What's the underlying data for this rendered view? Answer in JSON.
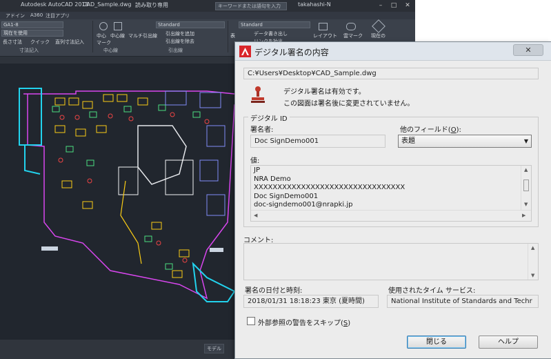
{
  "acad": {
    "title_app": "Autodesk AutoCAD 2018",
    "title_file": "CAD_Sample.dwg",
    "title_mode": "読み取り専用",
    "search_placeholder": "キーワードまたは語句を入力",
    "user": "takahashi-N",
    "menu": [
      "アドイン",
      "A360",
      "注目アプリ"
    ],
    "ribbon": {
      "layer_combo": "GA1-8",
      "current_use": "現在を使用",
      "dim_labels": [
        "長さ寸法",
        "クイック",
        "直列寸法記入"
      ],
      "panel_dim": "寸法記入",
      "center_mark": "中心\nマーク",
      "center_line": "中心線",
      "panel_center": "中心線",
      "mleader": "マルチ引出線",
      "style_combo1": "Standard",
      "add_leader": "引出線を追加",
      "remove_leader": "引出線を除去",
      "panel_leader": "引出線",
      "style_combo2": "Standard",
      "table": "表",
      "data_write": "データ書き出し",
      "data_link": "リンクを抽出",
      "layout": "レイアウト",
      "cloud_mark": "雲マーク",
      "current_view": "現在の"
    },
    "status_tab": "モデル"
  },
  "dialog": {
    "title": "デジタル署名の内容",
    "close_glyph": "✕",
    "file_path": "C:¥Users¥Desktop¥CAD_Sample.dwg",
    "message_valid": "デジタル署名は有効です。",
    "message_unchanged": "この図面は署名後に変更されていません。",
    "group_id": "デジタル ID",
    "signer_label": "署名者:",
    "signer_value": "Doc SignDemo001",
    "other_fields_label_prefix": "他のフィールド(",
    "other_fields_label_key": "O",
    "other_fields_label_suffix": "):",
    "other_fields_selected": "表題",
    "value_label": "値:",
    "value_lines": "JP\nNRA Demo\nXXXXXXXXXXXXXXXXXXXXXXXXXXXXXXXX\nDoc SignDemo001\ndoc-signdemo001@nrapki.jp",
    "comment_label": "コメント:",
    "date_label": "署名の日付と時刻:",
    "date_value": "2018/01/31  18:18:23 東京 (夏時間)",
    "tsa_label": "使用されたタイム サービス:",
    "tsa_value": "National Institute of Standards and Techr",
    "skip_xref_prefix": "外部参照の警告をスキップ(",
    "skip_xref_key": "S",
    "skip_xref_suffix": ")",
    "btn_close": "閉じる",
    "btn_help": "ヘルプ"
  },
  "colors": {
    "cad_background": "#21262e",
    "dialog_background": "#ececec",
    "autocad_logo": "#d9262b",
    "stamp": "#c0392b"
  }
}
